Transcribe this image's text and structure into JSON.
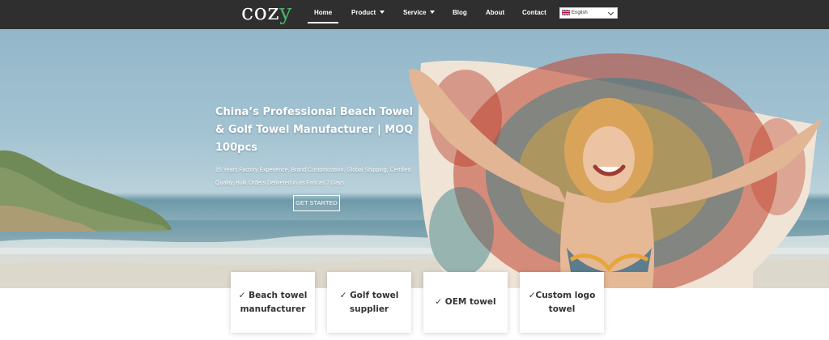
{
  "header": {
    "logo_text": "coz",
    "logo_accent": "y",
    "nav": [
      {
        "label": "Home",
        "has_dropdown": false,
        "active": true
      },
      {
        "label": "Product",
        "has_dropdown": true
      },
      {
        "label": "Service",
        "has_dropdown": true
      },
      {
        "label": "Blog",
        "has_dropdown": false
      },
      {
        "label": "About",
        "has_dropdown": false
      },
      {
        "label": "Contact",
        "has_dropdown": false
      }
    ],
    "language": {
      "label": "English",
      "flag_icon": "uk-flag-icon"
    }
  },
  "hero": {
    "title": "China’s Professional Beach Towel & Golf Towel Manufacturer | MOQ 100pcs",
    "subtitle": "15 Years Factory Experience, Brand Customization, Global Shipping, Certified Quality, Bulk Orders Delivered in as Fast as 7 Days",
    "cta_label": "GET STARTED"
  },
  "features": [
    {
      "label": "✓ Beach towel manufacturer"
    },
    {
      "label": "✓ Golf towel supplier"
    },
    {
      "label": "✓ OEM towel"
    },
    {
      "label": "✓Custom logo towel"
    }
  ],
  "colors": {
    "nav_bg": "#2f2f2f",
    "logo_accent": "#47b36a",
    "text_light": "#ffffff"
  }
}
